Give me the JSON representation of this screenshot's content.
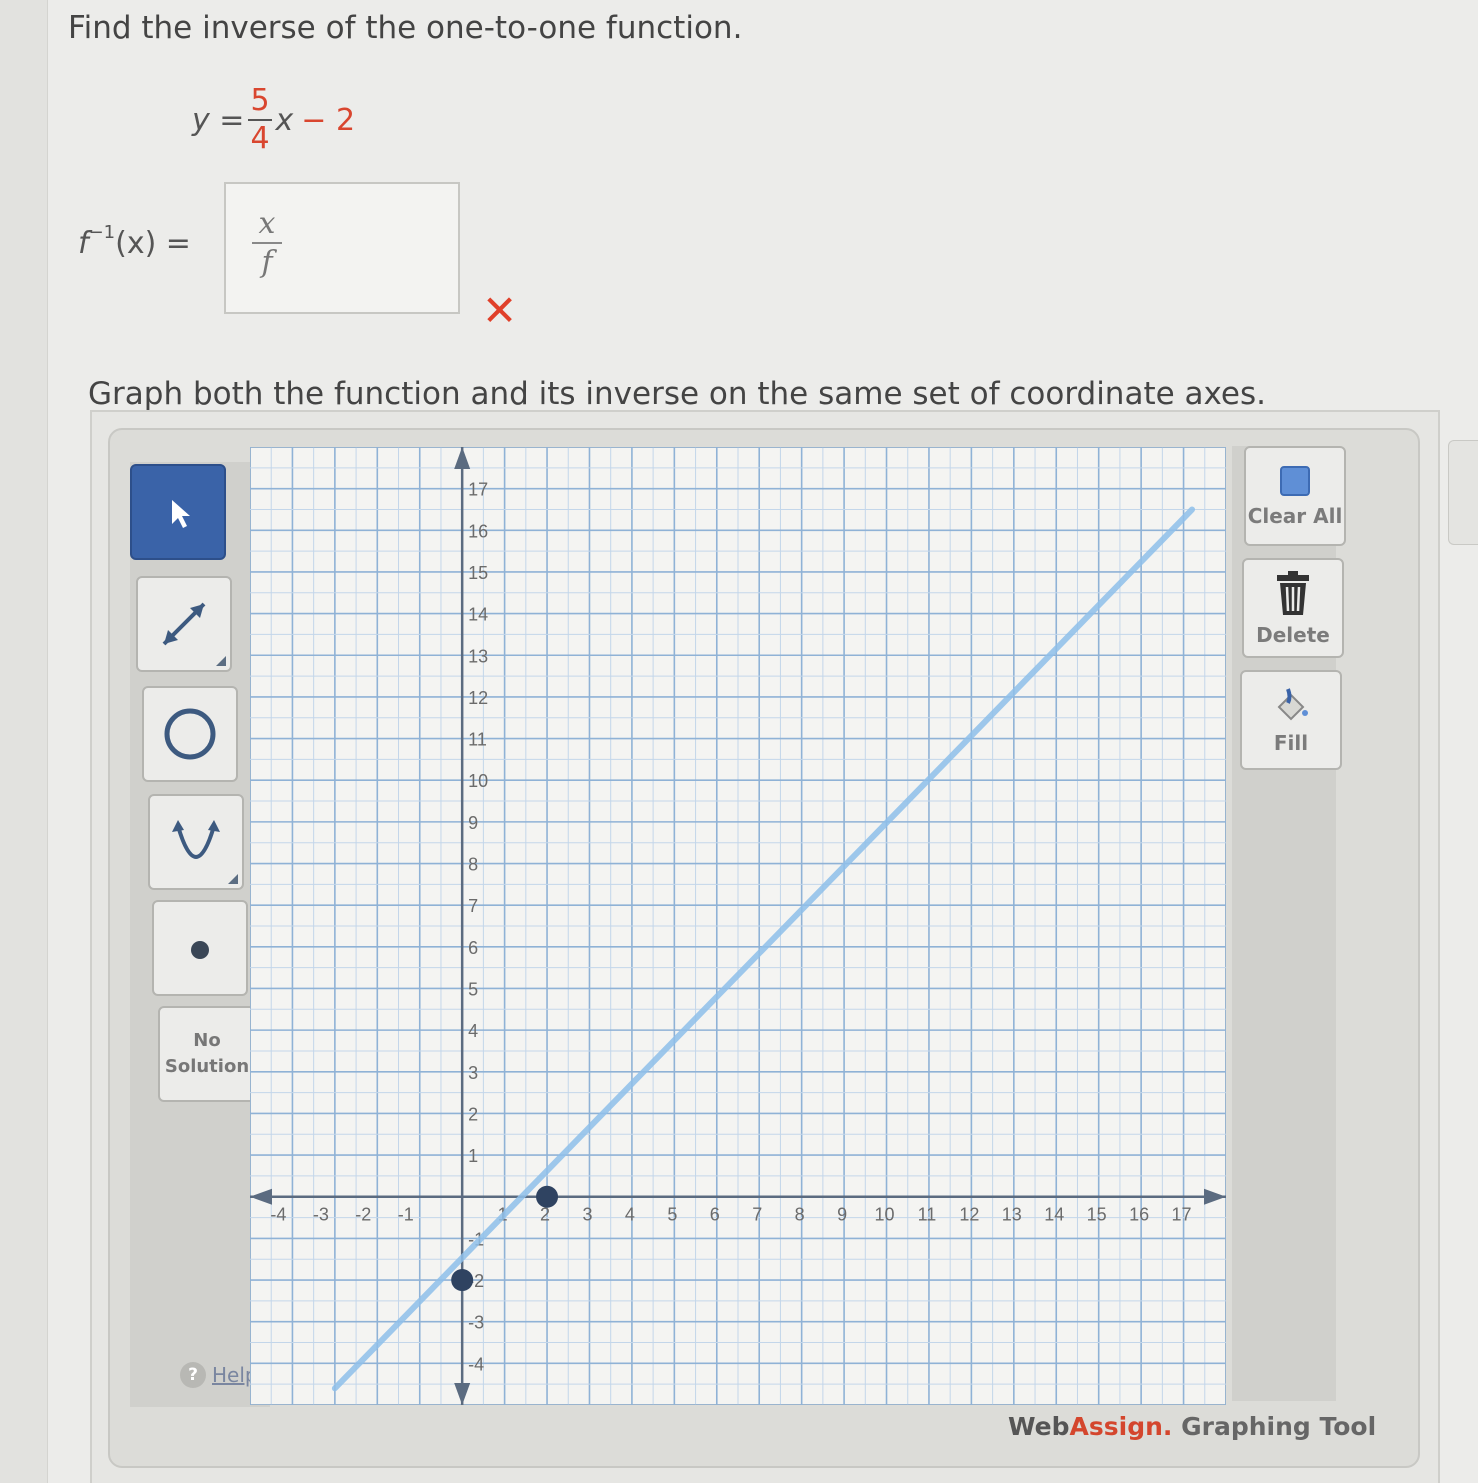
{
  "prompt": "Find the inverse of the one-to-one function.",
  "equation": {
    "lhs": "y =",
    "numerator": "5",
    "denominator": "4",
    "variable": "x",
    "rest": "− 2"
  },
  "inverse": {
    "label_f": "f",
    "label_exp": "−1",
    "label_rest": "(x) =",
    "answer_numerator": "x",
    "answer_denominator": "f",
    "status_icon": "x-mark-icon"
  },
  "instruction": "Graph both the function and its inverse on the same set of coordinate axes.",
  "toolbar": {
    "tools": [
      {
        "name": "pointer-icon",
        "active": true
      },
      {
        "name": "line-segment-icon",
        "active": false
      },
      {
        "name": "circle-icon",
        "active": false
      },
      {
        "name": "parabola-icon",
        "active": false
      },
      {
        "name": "point-icon",
        "active": false
      }
    ],
    "no_solution_line1": "No",
    "no_solution_line2": "Solution",
    "help_label": "Help"
  },
  "actions": {
    "clear_all_label": "Clear All",
    "delete_label": "Delete",
    "fill_label": "Fill"
  },
  "brand": {
    "web": "Web",
    "assign": "Assign.",
    "tool": " Graphing Tool"
  },
  "chart_data": {
    "type": "line",
    "xlim": [
      -5,
      18
    ],
    "ylim": [
      -5,
      18
    ],
    "x_ticks": [
      -4,
      -3,
      -2,
      -1,
      1,
      2,
      3,
      4,
      5,
      6,
      7,
      8,
      9,
      10,
      11,
      12,
      13,
      14,
      15,
      16,
      17
    ],
    "y_ticks": [
      -4,
      -3,
      -2,
      -1,
      1,
      2,
      3,
      4,
      5,
      6,
      7,
      8,
      9,
      10,
      11,
      12,
      13,
      14,
      15,
      16,
      17
    ],
    "grid": true,
    "series": [
      {
        "kind": "line",
        "points": [
          [
            -3,
            -4.6
          ],
          [
            17.2,
            16.5
          ]
        ],
        "color": "#8fc0ea"
      }
    ],
    "points": [
      {
        "x": 0,
        "y": -2,
        "color": "#2f4361"
      },
      {
        "x": 2,
        "y": 0,
        "color": "#2f4361"
      }
    ]
  }
}
